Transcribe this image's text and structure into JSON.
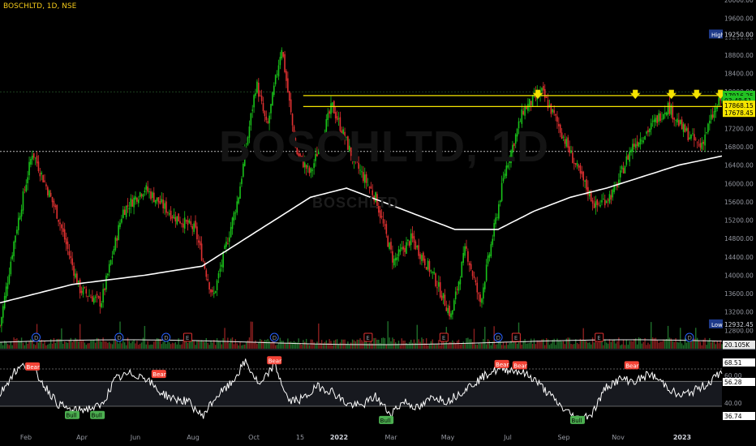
{
  "header": {
    "title": "BOSCHLTD, 1D, NSE"
  },
  "watermark": {
    "main": "BOSCHLTD, 1D",
    "sub": "BOSCHLTD"
  },
  "colors": {
    "up": "#26a69a",
    "up_bar": "#19c219",
    "down": "#e03131",
    "ma": "#ffffff",
    "resistance": "#f5e400",
    "rsi": "#ffffff",
    "rsi_band": "#2a2e39",
    "high_label": "#1e3a8a",
    "low_label": "#1e3a8a"
  },
  "chart_data": [
    {
      "type": "candlestick",
      "title": "BOSCHLTD, 1D, NSE",
      "ylim": [
        12400,
        20000
      ],
      "y_ticks": [
        12800,
        13200,
        13600,
        14000,
        14400,
        14800,
        15200,
        15600,
        16000,
        16400,
        16800,
        17200,
        17600,
        18000,
        18400,
        18800,
        19200,
        19600,
        20000
      ],
      "x_tick_labels": [
        "Feb",
        "Apr",
        "Jun",
        "Aug",
        "Oct",
        "15",
        "2022",
        "Mar",
        "May",
        "Jul",
        "Sep",
        "Nov",
        "2023"
      ],
      "close_path": [
        {
          "t": 0.0,
          "v": 12900
        },
        {
          "t": 0.02,
          "v": 14800
        },
        {
          "t": 0.045,
          "v": 16700
        },
        {
          "t": 0.08,
          "v": 15300
        },
        {
          "t": 0.11,
          "v": 13700
        },
        {
          "t": 0.14,
          "v": 13400
        },
        {
          "t": 0.17,
          "v": 15400
        },
        {
          "t": 0.2,
          "v": 15900
        },
        {
          "t": 0.24,
          "v": 15300
        },
        {
          "t": 0.27,
          "v": 15000
        },
        {
          "t": 0.295,
          "v": 13500
        },
        {
          "t": 0.33,
          "v": 15700
        },
        {
          "t": 0.355,
          "v": 18200
        },
        {
          "t": 0.37,
          "v": 17200
        },
        {
          "t": 0.39,
          "v": 19000
        },
        {
          "t": 0.41,
          "v": 16700
        },
        {
          "t": 0.43,
          "v": 16200
        },
        {
          "t": 0.46,
          "v": 17700
        },
        {
          "t": 0.49,
          "v": 16500
        },
        {
          "t": 0.52,
          "v": 15700
        },
        {
          "t": 0.545,
          "v": 14300
        },
        {
          "t": 0.57,
          "v": 14800
        },
        {
          "t": 0.6,
          "v": 14000
        },
        {
          "t": 0.625,
          "v": 13100
        },
        {
          "t": 0.645,
          "v": 14600
        },
        {
          "t": 0.665,
          "v": 13400
        },
        {
          "t": 0.7,
          "v": 16300
        },
        {
          "t": 0.725,
          "v": 17600
        },
        {
          "t": 0.75,
          "v": 18000
        },
        {
          "t": 0.77,
          "v": 17400
        },
        {
          "t": 0.8,
          "v": 16300
        },
        {
          "t": 0.825,
          "v": 15500
        },
        {
          "t": 0.85,
          "v": 15800
        },
        {
          "t": 0.875,
          "v": 16800
        },
        {
          "t": 0.9,
          "v": 17200
        },
        {
          "t": 0.925,
          "v": 17700
        },
        {
          "t": 0.945,
          "v": 17200
        },
        {
          "t": 0.97,
          "v": 16800
        },
        {
          "t": 0.985,
          "v": 17400
        },
        {
          "t": 1.0,
          "v": 17900
        }
      ],
      "moving_average": [
        {
          "t": 0.0,
          "v": 13400
        },
        {
          "t": 0.1,
          "v": 13800
        },
        {
          "t": 0.2,
          "v": 14000
        },
        {
          "t": 0.28,
          "v": 14200
        },
        {
          "t": 0.33,
          "v": 14700
        },
        {
          "t": 0.38,
          "v": 15200
        },
        {
          "t": 0.43,
          "v": 15700
        },
        {
          "t": 0.48,
          "v": 15900
        },
        {
          "t": 0.53,
          "v": 15600
        },
        {
          "t": 0.58,
          "v": 15300
        },
        {
          "t": 0.63,
          "v": 15000
        },
        {
          "t": 0.69,
          "v": 15000
        },
        {
          "t": 0.74,
          "v": 15400
        },
        {
          "t": 0.79,
          "v": 15700
        },
        {
          "t": 0.84,
          "v": 15900
        },
        {
          "t": 0.88,
          "v": 16100
        },
        {
          "t": 0.94,
          "v": 16400
        },
        {
          "t": 1.0,
          "v": 16600
        }
      ],
      "resistance_levels": [
        17916.25,
        17678.45
      ],
      "resistance_start_t": 0.42,
      "dotted_levels": [
        18000,
        16700
      ],
      "down_arrows_t": [
        0.745,
        0.88,
        0.93,
        0.965,
        0.998
      ],
      "price_labels": [
        {
          "text": "19250.00",
          "tag": "High",
          "v": 19250
        },
        {
          "text": "17916.25",
          "v": 17916.25
        },
        {
          "text": "03:48:51",
          "v": 17810
        },
        {
          "text": "17868.15",
          "v": 17700
        },
        {
          "text": "17678.45",
          "v": 17540
        },
        {
          "text": "12932.45",
          "tag": "Low",
          "v": 12932.45
        }
      ],
      "volume": {
        "label": "20.105K",
        "event_markers": [
          {
            "t": 0.05,
            "text": "D"
          },
          {
            "t": 0.165,
            "text": "D"
          },
          {
            "t": 0.23,
            "text": "D"
          },
          {
            "t": 0.26,
            "text": "E"
          },
          {
            "t": 0.38,
            "text": "D"
          },
          {
            "t": 0.51,
            "text": "E"
          },
          {
            "t": 0.615,
            "text": "E"
          },
          {
            "t": 0.69,
            "text": "D"
          },
          {
            "t": 0.715,
            "text": "E"
          },
          {
            "t": 0.83,
            "text": "E"
          },
          {
            "t": 0.955,
            "text": "D"
          }
        ]
      }
    },
    {
      "type": "line",
      "title": "RSI",
      "ylim": [
        25,
        85
      ],
      "levels": [
        70,
        60,
        40
      ],
      "y_labels": [
        "68.51",
        "60.00",
        "56.28",
        "40.00",
        "36.74"
      ],
      "rsi_path": [
        {
          "t": 0.0,
          "v": 50
        },
        {
          "t": 0.02,
          "v": 68
        },
        {
          "t": 0.04,
          "v": 75
        },
        {
          "t": 0.06,
          "v": 58
        },
        {
          "t": 0.08,
          "v": 42
        },
        {
          "t": 0.1,
          "v": 36
        },
        {
          "t": 0.12,
          "v": 38
        },
        {
          "t": 0.14,
          "v": 40
        },
        {
          "t": 0.16,
          "v": 62
        },
        {
          "t": 0.18,
          "v": 66
        },
        {
          "t": 0.2,
          "v": 64
        },
        {
          "t": 0.22,
          "v": 52
        },
        {
          "t": 0.24,
          "v": 46
        },
        {
          "t": 0.26,
          "v": 44
        },
        {
          "t": 0.28,
          "v": 32
        },
        {
          "t": 0.3,
          "v": 48
        },
        {
          "t": 0.32,
          "v": 58
        },
        {
          "t": 0.34,
          "v": 76
        },
        {
          "t": 0.36,
          "v": 56
        },
        {
          "t": 0.38,
          "v": 74
        },
        {
          "t": 0.4,
          "v": 44
        },
        {
          "t": 0.42,
          "v": 46
        },
        {
          "t": 0.44,
          "v": 56
        },
        {
          "t": 0.46,
          "v": 52
        },
        {
          "t": 0.48,
          "v": 42
        },
        {
          "t": 0.5,
          "v": 40
        },
        {
          "t": 0.52,
          "v": 48
        },
        {
          "t": 0.54,
          "v": 34
        },
        {
          "t": 0.56,
          "v": 44
        },
        {
          "t": 0.58,
          "v": 38
        },
        {
          "t": 0.6,
          "v": 48
        },
        {
          "t": 0.62,
          "v": 44
        },
        {
          "t": 0.64,
          "v": 52
        },
        {
          "t": 0.66,
          "v": 60
        },
        {
          "t": 0.68,
          "v": 68
        },
        {
          "t": 0.7,
          "v": 70
        },
        {
          "t": 0.72,
          "v": 68
        },
        {
          "t": 0.74,
          "v": 62
        },
        {
          "t": 0.76,
          "v": 50
        },
        {
          "t": 0.78,
          "v": 38
        },
        {
          "t": 0.8,
          "v": 30
        },
        {
          "t": 0.82,
          "v": 34
        },
        {
          "t": 0.84,
          "v": 56
        },
        {
          "t": 0.86,
          "v": 62
        },
        {
          "t": 0.88,
          "v": 60
        },
        {
          "t": 0.9,
          "v": 66
        },
        {
          "t": 0.92,
          "v": 58
        },
        {
          "t": 0.94,
          "v": 48
        },
        {
          "t": 0.96,
          "v": 52
        },
        {
          "t": 0.98,
          "v": 58
        },
        {
          "t": 1.0,
          "v": 68
        }
      ],
      "divergence_labels": [
        {
          "t": 0.045,
          "v": 72,
          "text": "Bear",
          "kind": "bear"
        },
        {
          "t": 0.22,
          "v": 66,
          "text": "Bear",
          "kind": "bear"
        },
        {
          "t": 0.38,
          "v": 77,
          "text": "Bear",
          "kind": "bear"
        },
        {
          "t": 0.695,
          "v": 74,
          "text": "Bear",
          "kind": "bear"
        },
        {
          "t": 0.72,
          "v": 73,
          "text": "Bear",
          "kind": "bear"
        },
        {
          "t": 0.875,
          "v": 73,
          "text": "Bear",
          "kind": "bear"
        },
        {
          "t": 0.1,
          "v": 33,
          "text": "Bull",
          "kind": "bull"
        },
        {
          "t": 0.135,
          "v": 33,
          "text": "Bull",
          "kind": "bull"
        },
        {
          "t": 0.535,
          "v": 29,
          "text": "Bull",
          "kind": "bull"
        },
        {
          "t": 0.8,
          "v": 29,
          "text": "Bull",
          "kind": "bull"
        }
      ]
    }
  ]
}
